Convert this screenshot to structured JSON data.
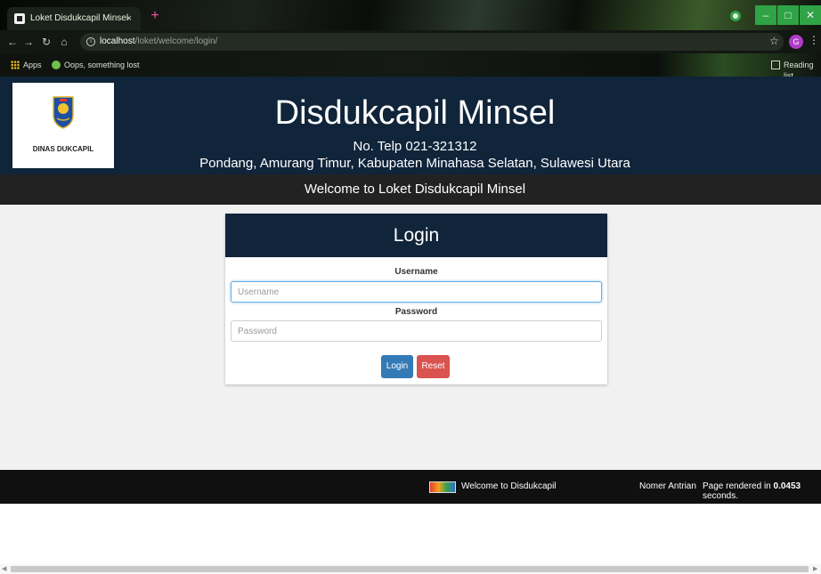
{
  "browser": {
    "tab_title": "Loket Disdukcapil Minsel",
    "tab_close": "×",
    "new_tab": "+",
    "url_host": "localhost",
    "url_path": "/loket/welcome/login/",
    "profile_initial": "G",
    "bookmarks": {
      "apps": "Apps",
      "oops": "Oops, something lost",
      "reading_list": "Reading list"
    }
  },
  "header": {
    "logo_text": "DINAS DUKCAPIL",
    "title": "Disdukcapil Minsel",
    "phone": "No. Telp 021-321312",
    "address": "Pondang, Amurang Timur, Kabupaten Minahasa Selatan, Sulawesi Utara",
    "welcome": "Welcome to Loket Disdukcapil Minsel"
  },
  "login": {
    "heading": "Login",
    "username_label": "Username",
    "username_placeholder": "Username",
    "username_value": "",
    "password_label": "Password",
    "password_placeholder": "Password",
    "password_value": "",
    "login_button": "Login",
    "reset_button": "Reset"
  },
  "footer": {
    "welcome": "Welcome to Disdukcapil",
    "antrian": "Nomer Antrian",
    "rendered_prefix": "Page rendered in ",
    "rendered_time": "0.0453",
    "rendered_suffix": " seconds."
  },
  "colors": {
    "header_bg": "#10243a",
    "welcome_bar_bg": "#222222",
    "login_btn": "#337ab7",
    "reset_btn": "#d9534f"
  }
}
